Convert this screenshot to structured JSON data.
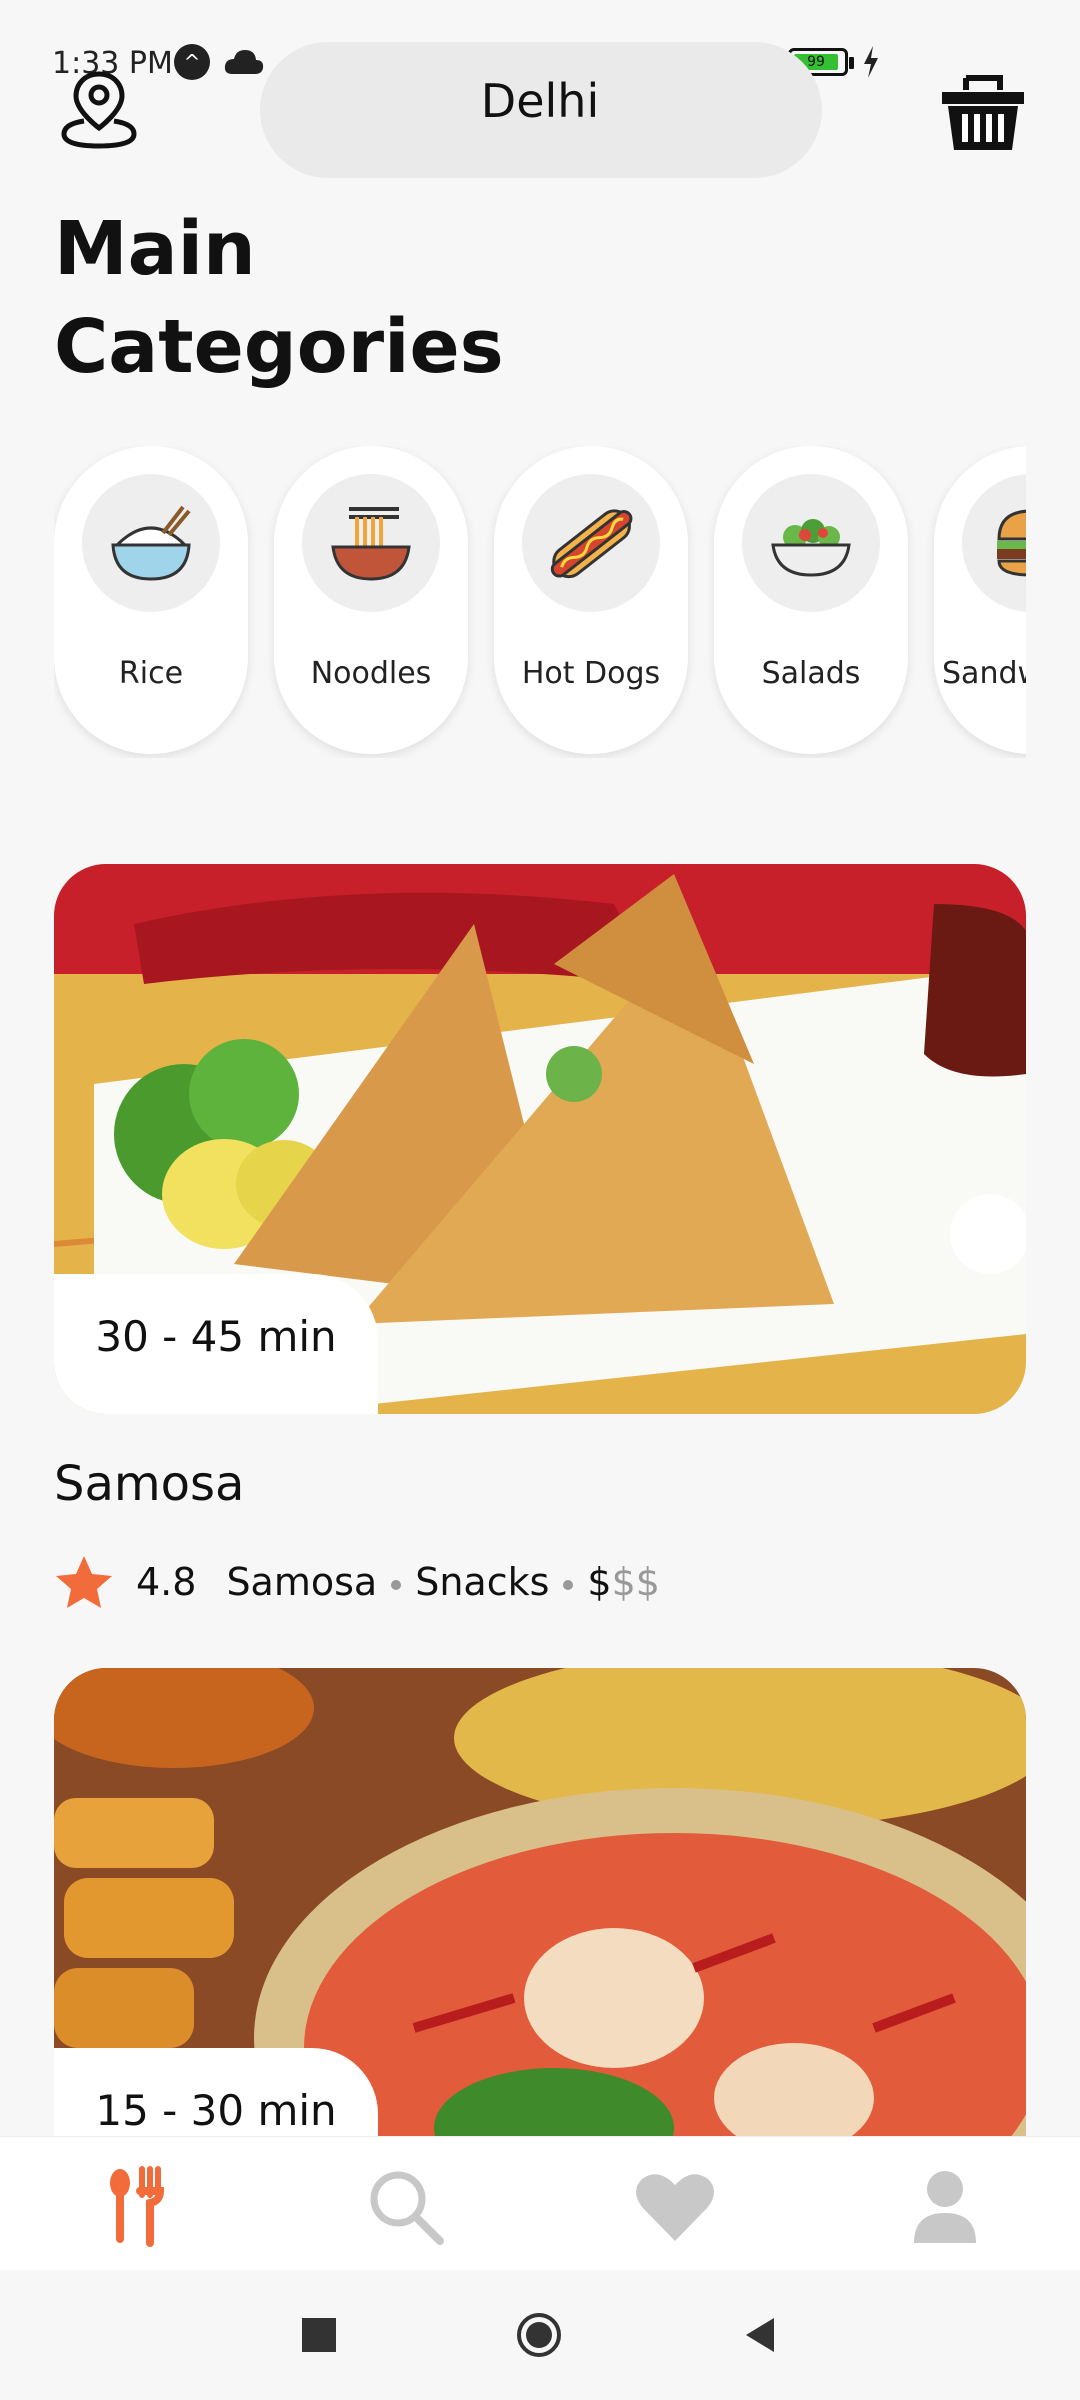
{
  "status_bar": {
    "time": "1:33 PM",
    "battery": "99"
  },
  "header": {
    "location": "Delhi",
    "location_icon": "location-pin-icon",
    "cart_icon": "basket-icon"
  },
  "page_title_line1": "Main",
  "page_title_line2": "Categories",
  "categories": [
    {
      "label": "Rice",
      "icon": "rice-bowl-icon"
    },
    {
      "label": "Noodles",
      "icon": "noodles-icon"
    },
    {
      "label": "Hot Dogs",
      "icon": "hot-dog-icon"
    },
    {
      "label": "Salads",
      "icon": "salad-icon"
    },
    {
      "label": "Sandwiches",
      "icon": "burger-icon"
    }
  ],
  "featured": [
    {
      "time": "30 - 45 min",
      "name": "Samosa",
      "rating": "4.8",
      "tag1": "Samosa",
      "tag2": "Snacks",
      "price_active": "$",
      "price_inactive": "$$"
    },
    {
      "time": "15 - 30 min"
    }
  ],
  "bottom_nav": [
    {
      "icon": "fork-knife-icon",
      "active": true
    },
    {
      "icon": "search-icon",
      "active": false
    },
    {
      "icon": "heart-icon",
      "active": false
    },
    {
      "icon": "user-icon",
      "active": false
    }
  ],
  "colors": {
    "accent": "#f26b3a",
    "inactive": "#c8c8c8"
  }
}
